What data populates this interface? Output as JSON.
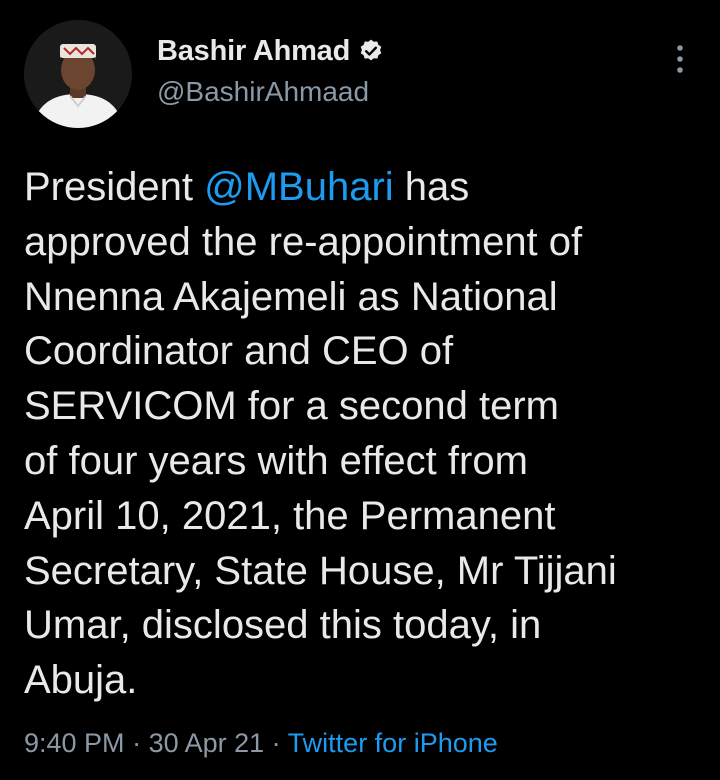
{
  "author": {
    "display_name": "Bashir Ahmad",
    "handle": "@BashirAhmaad",
    "verified": true,
    "avatar_icon": "profile-photo"
  },
  "tweet": {
    "lines": [
      {
        "before": "President ",
        "mention": "@MBuhari",
        "after": " has"
      },
      {
        "text": "approved the re-appointment of"
      },
      {
        "text": "Nnenna Akajemeli as National"
      },
      {
        "text": "Coordinator and CEO of"
      },
      {
        "text": "SERVICOM for a second term"
      },
      {
        "text": "of four years with effect from"
      },
      {
        "text": "April 10, 2021, the Permanent"
      },
      {
        "text": "Secretary, State House, Mr Tijjani"
      },
      {
        "text": "Umar, disclosed this today, in"
      },
      {
        "text": "Abuja."
      }
    ]
  },
  "meta": {
    "time": "9:40 PM",
    "separator1": " · ",
    "date": "30 Apr 21",
    "separator2": " · ",
    "source": "Twitter for iPhone"
  },
  "colors": {
    "background": "#000000",
    "text": "#e7e9ea",
    "secondary": "#8b98a5",
    "accent": "#1d9bf0"
  }
}
